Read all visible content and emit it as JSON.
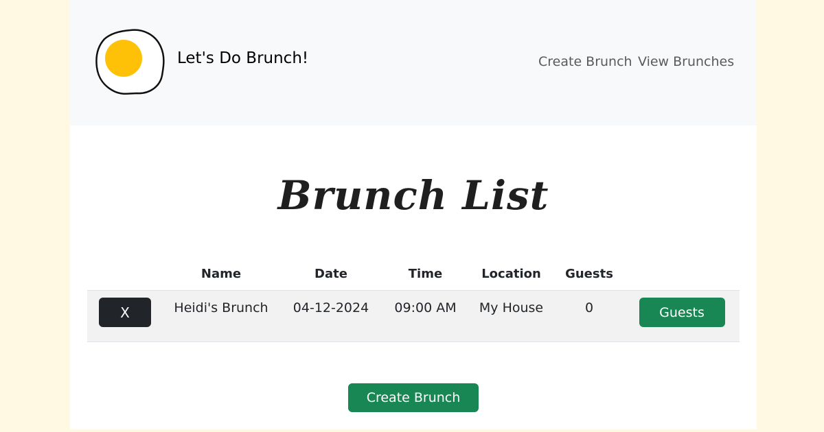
{
  "header": {
    "brand": "Let's Do Brunch!",
    "nav": {
      "create_brunch": "Create Brunch",
      "view_brunches": "View Brunches"
    }
  },
  "main": {
    "title": "Brunch List",
    "table": {
      "columns": [
        "",
        "Name",
        "Date",
        "Time",
        "Location",
        "Guests",
        ""
      ],
      "rows": [
        {
          "delete_label": "X",
          "name": "Heidi's Brunch",
          "date": "04-12-2024",
          "time": "09:00 AM",
          "location": "My House",
          "guests": "0",
          "guests_button": "Guests"
        }
      ]
    },
    "create_button": "Create Brunch"
  },
  "colors": {
    "background": "#fff8e3",
    "navbar": "#f8f9fa",
    "primary_green": "#198754",
    "dark_button": "#212529",
    "egg_yolk": "#ffc107"
  },
  "icons": {
    "logo": "fried-egg-icon"
  }
}
